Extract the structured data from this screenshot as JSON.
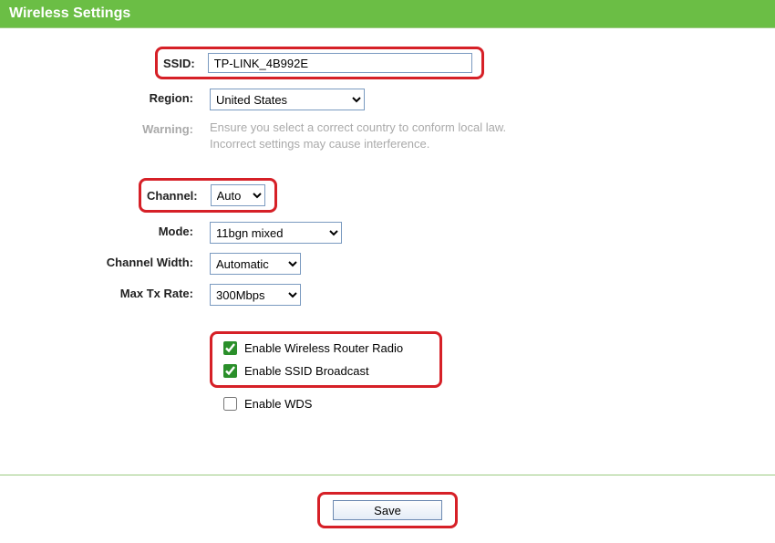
{
  "header": {
    "title": "Wireless Settings"
  },
  "form": {
    "ssid": {
      "label": "SSID:",
      "value": "TP-LINK_4B992E"
    },
    "region": {
      "label": "Region:",
      "value": "United States"
    },
    "warning": {
      "label": "Warning:",
      "text1": "Ensure you select a correct country to conform local law.",
      "text2": "Incorrect settings may cause interference."
    },
    "channel": {
      "label": "Channel:",
      "value": "Auto"
    },
    "mode": {
      "label": "Mode:",
      "value": "11bgn mixed"
    },
    "channel_width": {
      "label": "Channel Width:",
      "value": "Automatic"
    },
    "max_tx": {
      "label": "Max Tx Rate:",
      "value": "300Mbps"
    },
    "enable_radio": {
      "label": "Enable Wireless Router Radio"
    },
    "enable_ssid": {
      "label": "Enable SSID Broadcast"
    },
    "enable_wds": {
      "label": "Enable WDS"
    },
    "save": {
      "label": "Save"
    }
  }
}
